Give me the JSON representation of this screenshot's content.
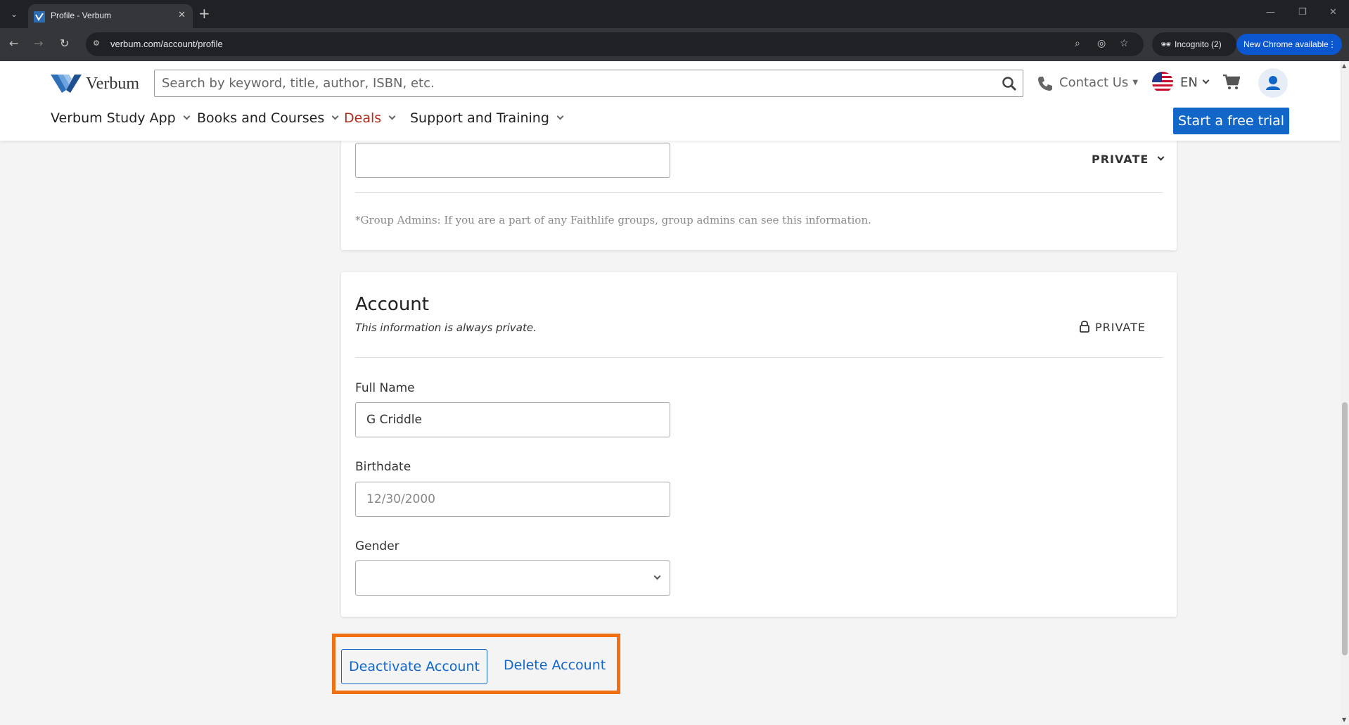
{
  "browser": {
    "tab_title": "Profile - Verbum",
    "url": "verbum.com/account/profile",
    "incognito_label": "Incognito (2)",
    "update_label": "New Chrome available"
  },
  "header": {
    "logo_text": "Verbum",
    "search_placeholder": "Search by keyword, title, author, ISBN, etc.",
    "contact_label": "Contact Us",
    "language": "EN",
    "nav": {
      "study_app": "Verbum Study App",
      "books": "Books and Courses",
      "deals": "Deals",
      "support": "Support and Training"
    },
    "trial_button": "Start a free trial"
  },
  "group_card": {
    "privacy": "PRIVATE",
    "note": "*Group Admins: If you are a part of any Faithlife groups, group admins can see this information."
  },
  "account_card": {
    "title": "Account",
    "subtitle": "This information is always private.",
    "privacy": "PRIVATE",
    "full_name_label": "Full Name",
    "full_name_value": "G Criddle",
    "birthdate_label": "Birthdate",
    "birthdate_value": "12/30/2000",
    "gender_label": "Gender",
    "gender_value": ""
  },
  "actions": {
    "deactivate": "Deactivate Account",
    "delete": "Delete Account"
  },
  "colors": {
    "brand_blue": "#1166c8",
    "deals_red": "#b02a1e",
    "highlight_orange": "#f07114"
  }
}
